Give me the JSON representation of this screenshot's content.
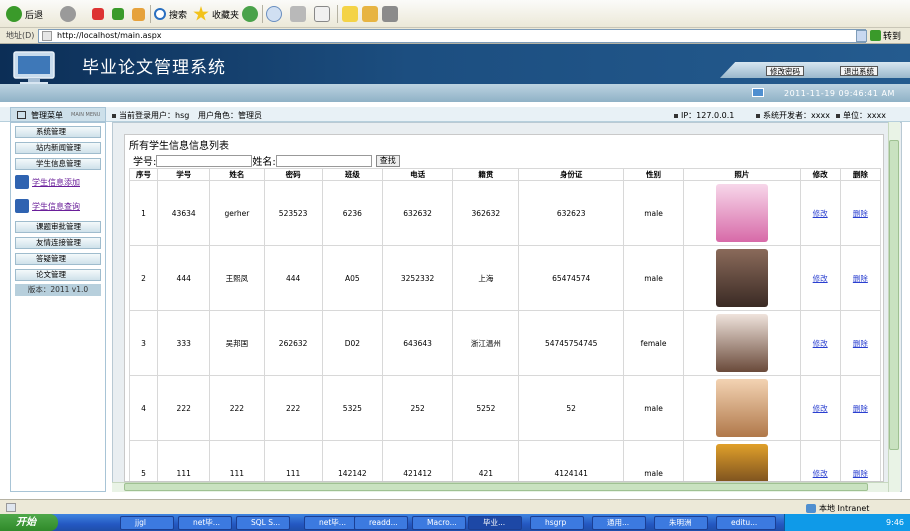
{
  "browser": {
    "back_label": "后退",
    "search_label": "搜索",
    "favorites_label": "收藏夹",
    "address_label": "地址(D)",
    "url": "http://localhost/main.aspx",
    "go_label": "转到"
  },
  "app": {
    "title": "毕业论文管理系统",
    "change_password": "修改密码",
    "logout": "退出系统",
    "datetime": "2011-11-19 09:46:41 AM"
  },
  "userbar": {
    "menu_title": "管理菜单",
    "menu_sub": "MAIN MENU",
    "current_user": "当前登录用户：hsg",
    "role": "用户角色：管理员",
    "ip": "IP：127.0.0.1",
    "developer": "系统开发者：xxxx",
    "unit": "单位：xxxx"
  },
  "sidebar": {
    "items": [
      {
        "label": "系统管理"
      },
      {
        "label": "站内新闻管理"
      },
      {
        "label": "学生信息管理"
      },
      {
        "label": "学生信息添加"
      },
      {
        "label": "学生信息查询"
      },
      {
        "label": "课题审批管理"
      },
      {
        "label": "友情连接管理"
      },
      {
        "label": "答疑管理"
      },
      {
        "label": "论文管理"
      }
    ],
    "version": "版本：2011 v1.0"
  },
  "list": {
    "title": "所有学生信息信息列表",
    "label_no": "学号:",
    "label_name": "姓名:",
    "search_button": "查找",
    "columns": [
      "序号",
      "学号",
      "姓名",
      "密码",
      "班级",
      "电话",
      "籍贯",
      "身份证",
      "性别",
      "照片",
      "修改",
      "删除"
    ],
    "edit_label": "修改",
    "delete_label": "删除",
    "rows": [
      {
        "seq": "1",
        "no": "43634",
        "name": "gerher",
        "pwd": "523523",
        "cls": "6236",
        "phone": "632632",
        "origin": "362632",
        "id": "632623",
        "sex": "male"
      },
      {
        "seq": "2",
        "no": "444",
        "name": "王熙凤",
        "pwd": "444",
        "cls": "A05",
        "phone": "3252332",
        "origin": "上海",
        "id": "65474574",
        "sex": "male"
      },
      {
        "seq": "3",
        "no": "333",
        "name": "吴邦国",
        "pwd": "262632",
        "cls": "D02",
        "phone": "643643",
        "origin": "浙江温州",
        "id": "54745754745",
        "sex": "female"
      },
      {
        "seq": "4",
        "no": "222",
        "name": "222",
        "pwd": "222",
        "cls": "5325",
        "phone": "252",
        "origin": "5252",
        "id": "52",
        "sex": "male"
      },
      {
        "seq": "5",
        "no": "111",
        "name": "111",
        "pwd": "111",
        "cls": "142142",
        "phone": "421412",
        "origin": "421",
        "id": "4124141",
        "sex": "male"
      }
    ]
  },
  "statusbar": {
    "zone": "本地 Intranet"
  },
  "taskbar": {
    "start": "开始",
    "tasks": [
      "jjgl",
      "net毕...",
      "SQL S...",
      "net毕...",
      "readd...",
      "Macro...",
      "毕业...",
      "hsgrp",
      "通用...",
      "朱明洲",
      "editu..."
    ],
    "clock": "9:46"
  },
  "colors": {
    "header_dark": "#0c2e56",
    "link_purple": "#6a1f9a",
    "link_blue": "#2a3fd0"
  }
}
